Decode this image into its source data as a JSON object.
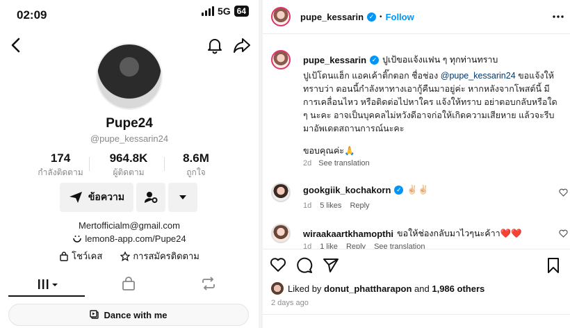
{
  "status_bar": {
    "time": "02:09",
    "network": "5G",
    "battery": "64"
  },
  "profile": {
    "name": "Pupe24",
    "handle": "@pupe_kessarin24",
    "stats": [
      {
        "value": "174",
        "label": "กำลังติดตาม"
      },
      {
        "value": "964.8K",
        "label": "ผู้ติดตาม"
      },
      {
        "value": "8.6M",
        "label": "ถูกใจ"
      }
    ],
    "message_label": "ข้อความ",
    "email": "Mertofficialm@gmail.com",
    "link": "lemon8-app.com/Pupe24",
    "showcase_label": "โชว์เคส",
    "subscribe_label": "การสมัครติดตาม",
    "dance_label": "Dance with me"
  },
  "post": {
    "author": "pupe_kessarin",
    "follow_label": "Follow",
    "caption_title": "ปูเป้ขอแจ้งแฟน ๆ ทุกท่านทราบ",
    "caption_pre": "ปูเป้โดนแฮ็ก แอคเค้าติ๊กตอก ชื่อช่อง ",
    "caption_mention": "@pupe_kessarin24",
    "caption_post": " ขอแจ้งให้ทราบว่า ตอนนี้กำลังหาทางเอากู้คืนมาอยู่ค่ะ หากหลังจากโพสต์นี้ มีการเคลื่อนไหว หรือติดต่อไปหาใคร แจ้งให้ทราบ อย่าตอบกลับหรือใด ๆ นะคะ อาจเป็นบุคคลไม่หวังดีอาจก่อให้เกิดความเสียหาย แล้วจะรีบมาอัพเดตสถานการณ์นะคะ",
    "caption_thanks": "ขอบคุณค่ะ🙏",
    "caption_age": "2d",
    "see_translation": "See translation",
    "comments": [
      {
        "user": "gookgiik_kochakorn",
        "text": "✌🏻✌🏻",
        "age": "1d",
        "likes": "5 likes",
        "reply": "Reply"
      },
      {
        "user": "wiraakaartkhamopthi",
        "text": "ขอให้ช่องกลับมาไวๆนะค้าา❤️❤️",
        "age": "1d",
        "likes": "1 like",
        "reply": "Reply",
        "see_translation": "See translation"
      }
    ],
    "liked_prefix": "Liked by ",
    "liked_user": "donut_phattharapon",
    "liked_and": " and ",
    "liked_others": "1,986 others",
    "posted_ago": "2 days ago"
  }
}
